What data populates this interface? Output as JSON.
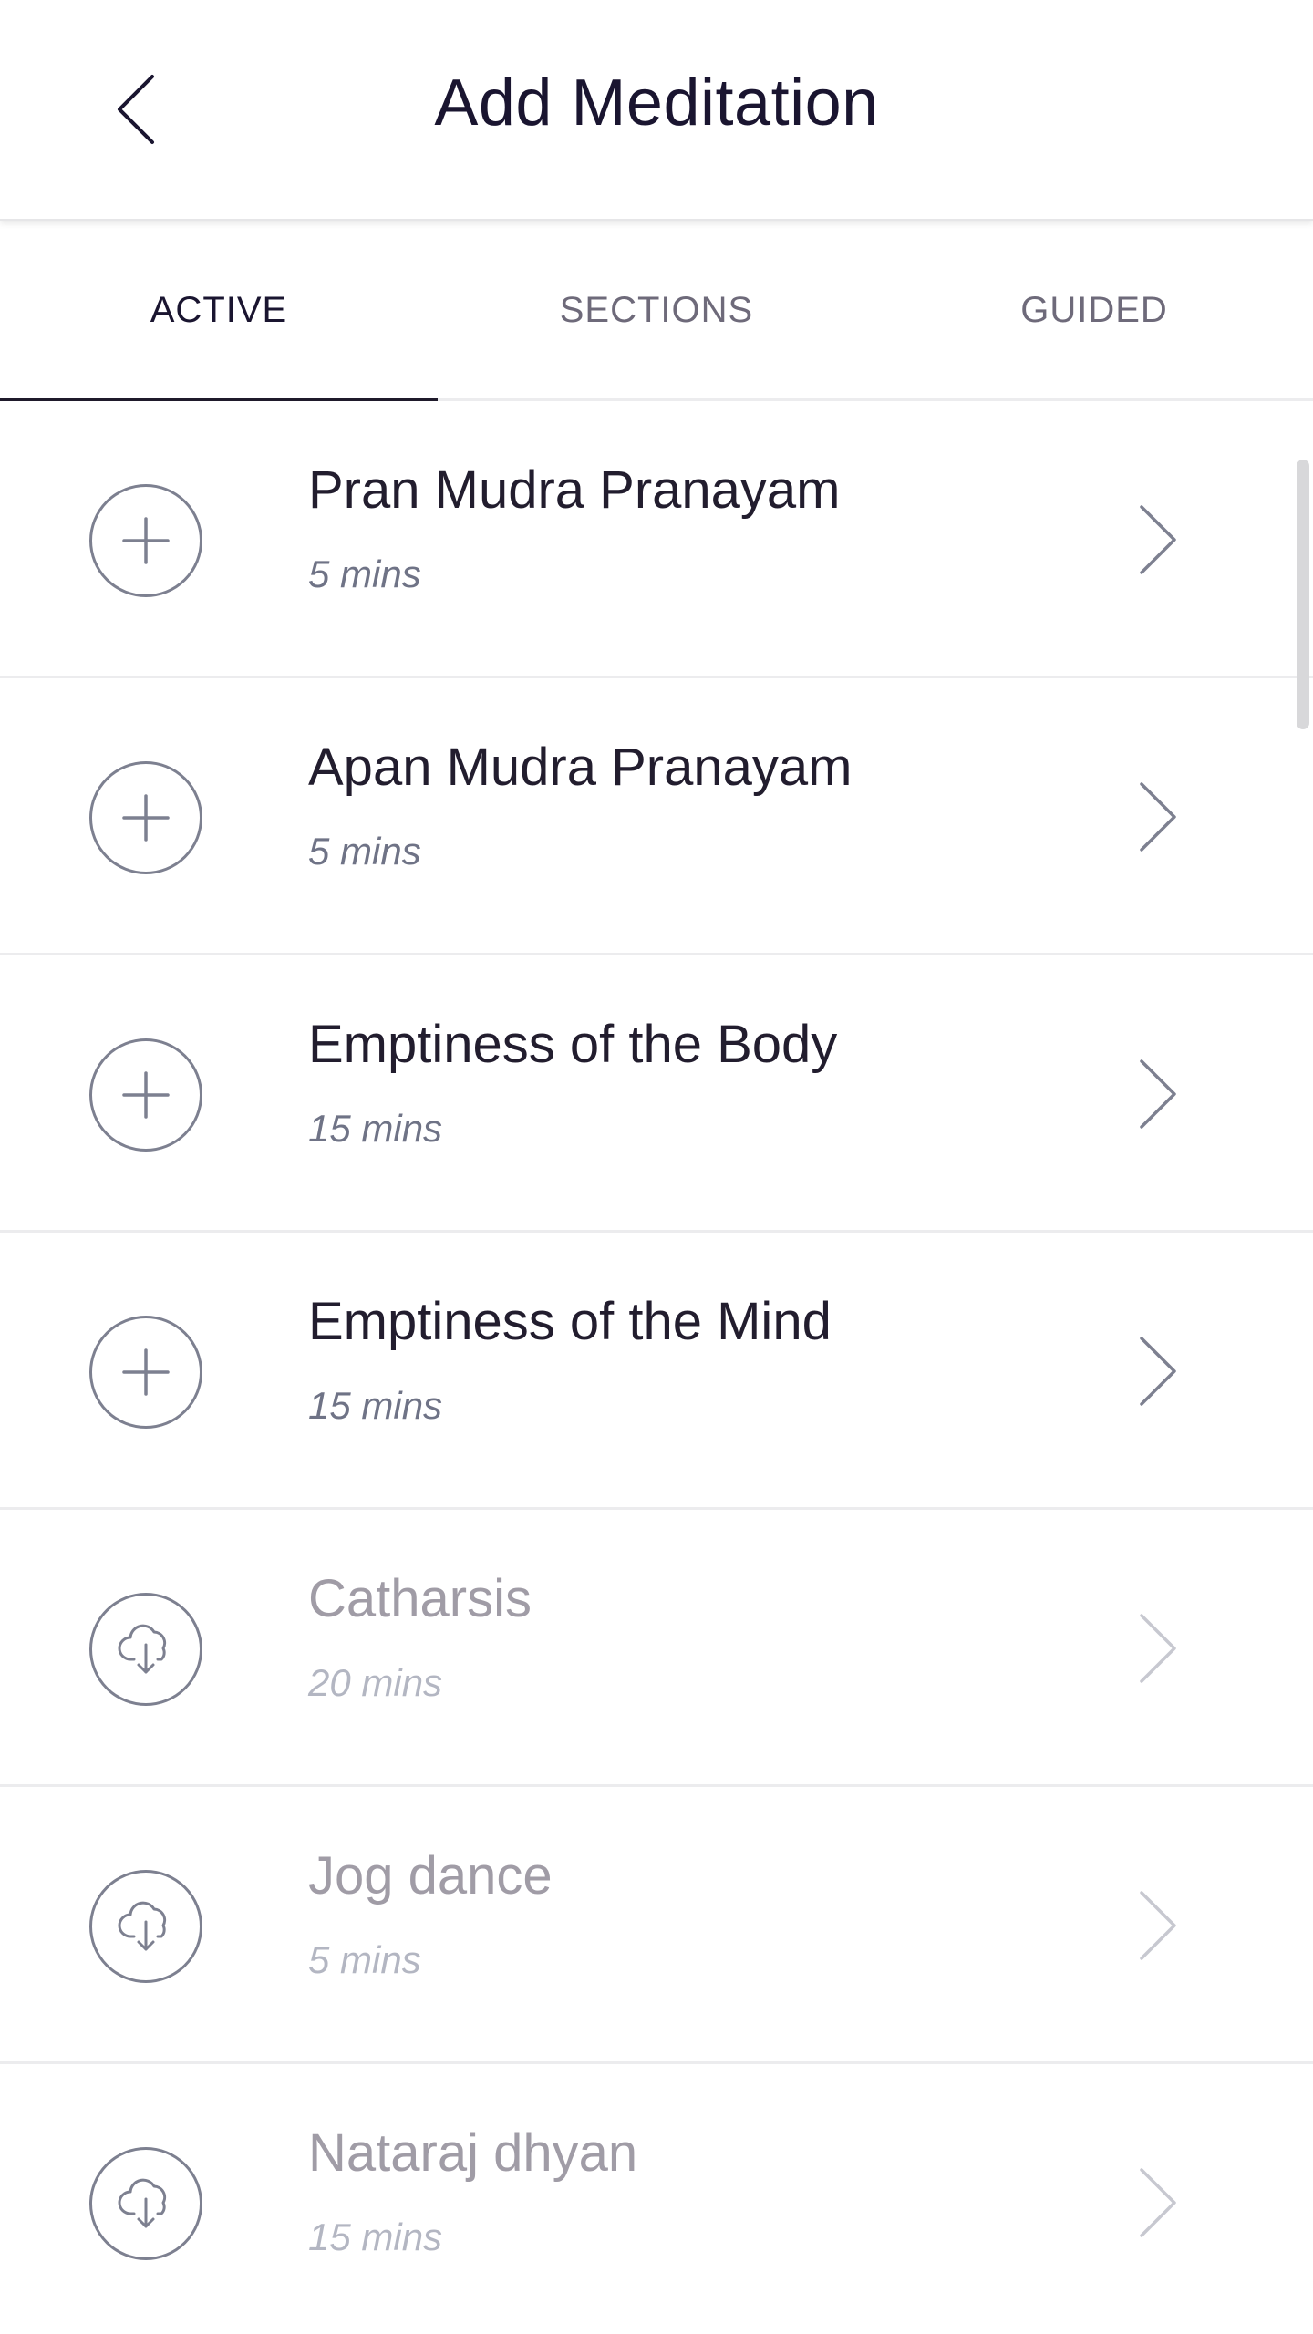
{
  "header": {
    "title": "Add Meditation"
  },
  "tabs": [
    {
      "label": "ACTIVE",
      "active": true
    },
    {
      "label": "SECTIONS",
      "active": false
    },
    {
      "label": "GUIDED",
      "active": false
    }
  ],
  "meditations": [
    {
      "title": "Pran Mudra Pranayam",
      "duration": "5 mins",
      "action": "plus-icon"
    },
    {
      "title": "Apan Mudra Pranayam",
      "duration": "5 mins",
      "action": "plus-icon"
    },
    {
      "title": "Emptiness of the Body",
      "duration": "15 mins",
      "action": "plus-icon"
    },
    {
      "title": "Emptiness of the Mind",
      "duration": "15 mins",
      "action": "plus-icon"
    },
    {
      "title": "Catharsis",
      "duration": "20 mins",
      "action": "cloud-download-icon"
    },
    {
      "title": "Jog dance",
      "duration": "5 mins",
      "action": "cloud-download-icon"
    },
    {
      "title": "Nataraj dhyan",
      "duration": "15 mins",
      "action": "cloud-download-icon"
    }
  ],
  "colors": {
    "title_text": "#1a1530",
    "icon_stroke": "#7d8090",
    "dim_text": "#a09ca6",
    "divider": "#ececee"
  }
}
